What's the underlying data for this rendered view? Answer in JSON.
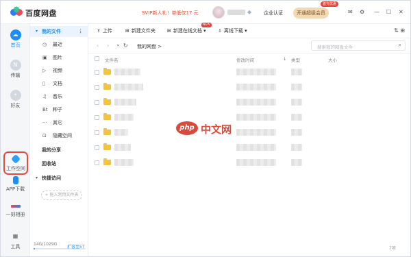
{
  "titlebar": {
    "brand": "百度网盘",
    "promo": "SVIP新人礼！单低仅17 元",
    "cert_label": "企业认证",
    "vip_button": "开通超级会员",
    "vip_badge": "首充优惠",
    "mail_icon": "✉",
    "gear_icon": "⚙",
    "min_icon": "—",
    "max_icon": "☐",
    "close_icon": "✕",
    "diamond_icon": "◆"
  },
  "rail": {
    "items": [
      {
        "label": "首页",
        "glyph": "☁"
      },
      {
        "label": "传输",
        "glyph": "N"
      },
      {
        "label": "好友",
        "glyph": "•"
      },
      {
        "label": "工作空间",
        "glyph": ""
      },
      {
        "label": "APP下载",
        "glyph": "▮"
      },
      {
        "label": "一刻相册",
        "glyph": "▬"
      },
      {
        "label": "工具",
        "glyph": "▦"
      }
    ]
  },
  "sidebar": {
    "my_files": "我的文件",
    "more_glyph": "⋮",
    "caret": "▾",
    "items": [
      {
        "icon": "◷",
        "label": "最近"
      },
      {
        "icon": "▣",
        "label": "图片"
      },
      {
        "icon": "▷",
        "label": "视频"
      },
      {
        "icon": "▯",
        "label": "文档"
      },
      {
        "icon": "♫",
        "label": "音乐"
      },
      {
        "icon": "Bt",
        "label": "种子"
      },
      {
        "icon": "···",
        "label": "其它"
      },
      {
        "icon": "⊡",
        "label": "隐藏空间"
      }
    ],
    "my_share": "我的分享",
    "recycle": "回收站",
    "quick_access": "快捷访问",
    "add_quick": "+ 拖入常用文件夹",
    "storage": "14G/1029G",
    "storage_used_fraction": 0.014,
    "expand": "扩容至5T"
  },
  "toolbar": {
    "upload": "上传",
    "upload_icon": "⇪",
    "new_folder": "新建文件夹",
    "new_folder_icon": "⊞",
    "new_online_doc": "新建在线文档",
    "new_online_doc_icon": "⊞",
    "new_badge": "NEW",
    "dropdown_glyph": "▾",
    "offline_download": "离线下载",
    "offline_icon": "⇩",
    "sort_icon": "⇅",
    "grid_icon": "⊞"
  },
  "pathbar": {
    "back": "‹",
    "forward": "›",
    "dropdown": "⌄",
    "refresh": "↻",
    "path": "我的网盘  >",
    "search_placeholder": "搜索我的网盘文件",
    "search_icon": "⌕"
  },
  "table": {
    "col_name": "文件名",
    "col_modified": "修改时间",
    "sort_arrow": "↓",
    "col_type": "类型",
    "col_size": "大小"
  },
  "footer": {
    "count": "7项"
  },
  "watermark": {
    "logo": "php",
    "text": "中文网"
  }
}
